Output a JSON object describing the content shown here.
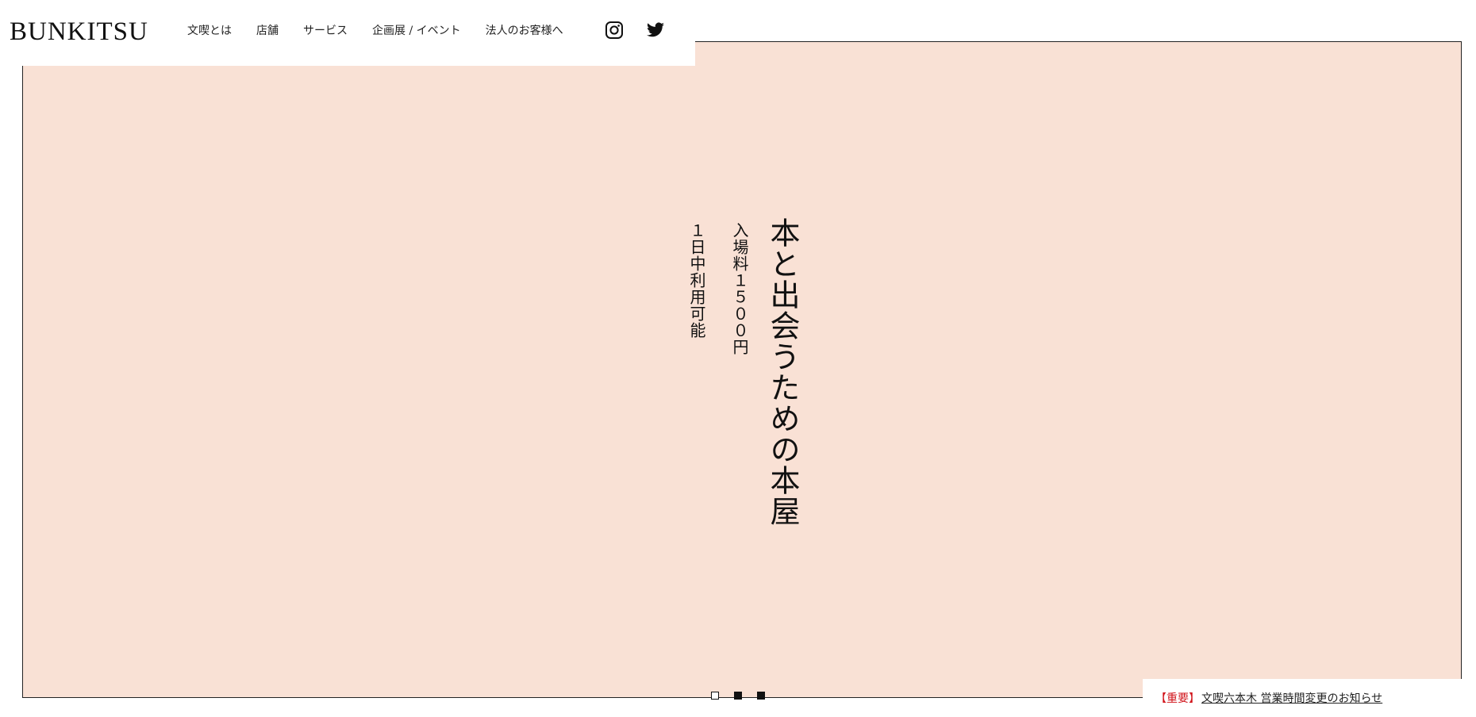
{
  "header": {
    "logo": "BUNKITSU",
    "nav": [
      {
        "label": "文喫とは"
      },
      {
        "label": "店舗"
      },
      {
        "label": "サービス"
      },
      {
        "label": "企画展 / イベント"
      },
      {
        "label": "法人のお客様へ"
      }
    ],
    "social": {
      "instagram_icon": "instagram-icon",
      "twitter_icon": "twitter-icon"
    }
  },
  "hero": {
    "background_color": "#f9e1d5",
    "headline": "本と出会うための本屋",
    "sub1": "入場料１５００円",
    "sub2": "１日中利用可能"
  },
  "slider": {
    "count": 3,
    "active_index": 0
  },
  "notice": {
    "tag": "【重要】",
    "tag_color": "#d1141b",
    "link": "文喫六本木 営業時間変更のお知らせ"
  }
}
